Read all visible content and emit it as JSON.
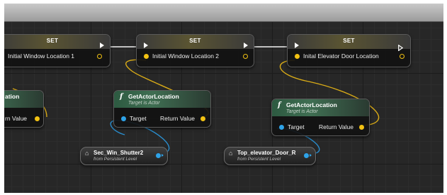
{
  "set_nodes": [
    {
      "title": "SET",
      "variable": "Initial Window Location 1"
    },
    {
      "title": "SET",
      "variable": "Initial Window Location 2"
    },
    {
      "title": "SET",
      "variable": "Inital Elevator Door Location"
    }
  ],
  "left_partial": {
    "title_fragment": "ation",
    "pin_label": "rn Value"
  },
  "function_nodes": [
    {
      "icon": "f",
      "title": "GetActorLocation",
      "subtitle": "Target is Actor",
      "target_label": "Target",
      "return_label": "Return Value"
    },
    {
      "icon": "f",
      "title": "GetActorLocation",
      "subtitle": "Target is Actor",
      "target_label": "Target",
      "return_label": "Return Value"
    }
  ],
  "variable_nodes": [
    {
      "name": "Sec_Win_Shutter2",
      "source": "from Persistent Level"
    },
    {
      "name": "Top_elevator_Door_R",
      "source": "from Persistent Level"
    }
  ],
  "colors": {
    "vector_pin": "#f2c213",
    "object_pin": "#2ea3e8",
    "exec_pin": "#ffffff",
    "function_header": "#3f6e52"
  },
  "icons": {
    "function": "function-f-icon",
    "variable": "actor-reference-icon",
    "exec": "exec-arrow-icon"
  }
}
